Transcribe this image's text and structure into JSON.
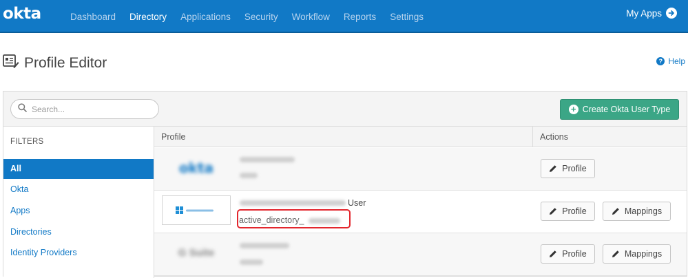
{
  "nav": {
    "logo": "okta",
    "items": [
      {
        "label": "Dashboard",
        "active": false
      },
      {
        "label": "Directory",
        "active": true
      },
      {
        "label": "Applications",
        "active": false
      },
      {
        "label": "Security",
        "active": false
      },
      {
        "label": "Workflow",
        "active": false
      },
      {
        "label": "Reports",
        "active": false
      },
      {
        "label": "Settings",
        "active": false
      }
    ],
    "my_apps": "My Apps"
  },
  "page": {
    "title": "Profile Editor",
    "help": "Help"
  },
  "toolbar": {
    "search_placeholder": "Search...",
    "create_button": "Create Okta User Type"
  },
  "filters": {
    "title": "FILTERS",
    "items": [
      "All",
      "Okta",
      "Apps",
      "Directories",
      "Identity Providers"
    ],
    "active_index": 0
  },
  "table": {
    "columns": [
      "Profile",
      "Actions"
    ],
    "rows": [
      {
        "name_suffix": "",
        "subtext": "",
        "actions": [
          "Profile"
        ]
      },
      {
        "name_suffix": "User",
        "subtext": "active_directory_",
        "actions": [
          "Profile",
          "Mappings"
        ]
      },
      {
        "name_suffix": "",
        "subtext": "",
        "actions": [
          "Profile",
          "Mappings"
        ]
      }
    ]
  },
  "colors": {
    "nav_bg": "#1179c6",
    "accent": "#1179c6",
    "create_button": "#3ba686",
    "highlight": "#e3262d"
  }
}
